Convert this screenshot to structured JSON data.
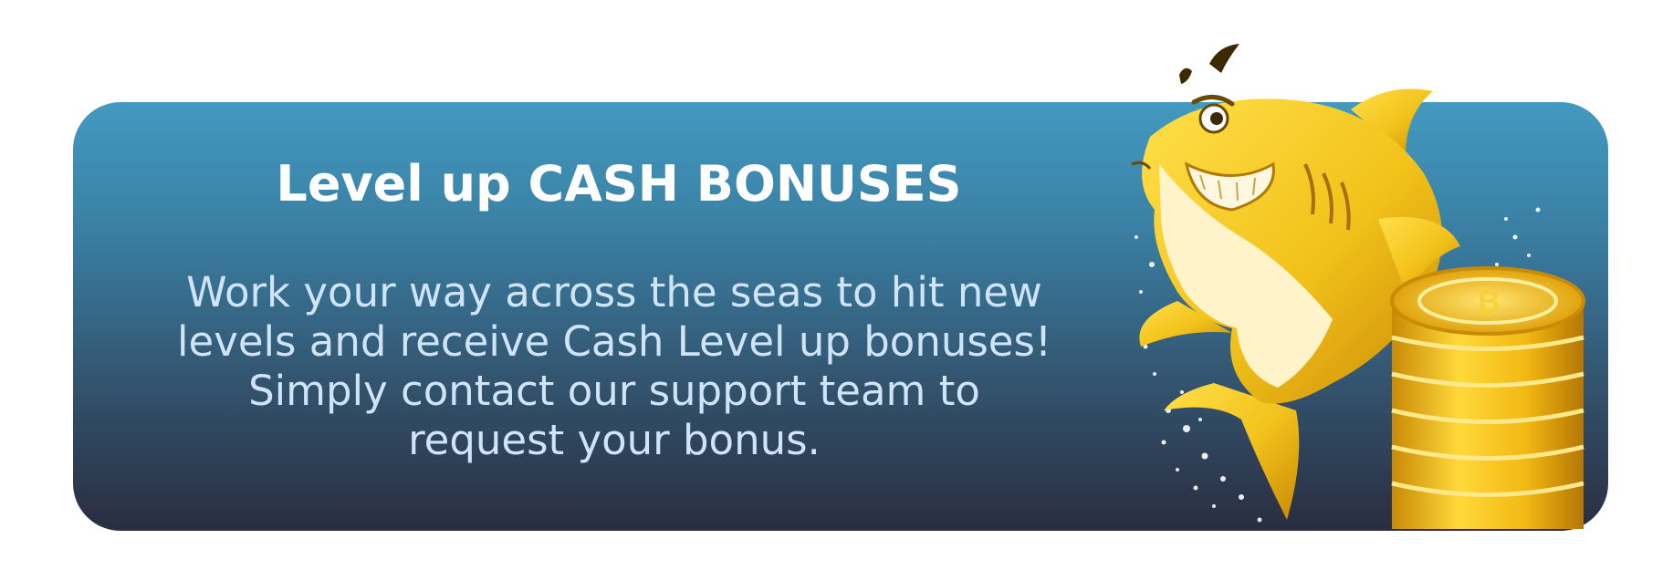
{
  "banner": {
    "title": "Level up CASH BONUSES",
    "body_lines": [
      "Work your way across the seas to hit new",
      "levels and receive Cash Level up bonuses!",
      "Simply contact our support team to",
      "request your bonus."
    ]
  },
  "mascot": {
    "icon": "shark-mascot-icon",
    "coins_icon": "coin-stack-icon"
  },
  "colors": {
    "gradient_top": "#4399c0",
    "gradient_bottom": "#2a2d40",
    "title": "#ffffff",
    "body": "#cfe4f6",
    "gold": "#f2c21a"
  }
}
